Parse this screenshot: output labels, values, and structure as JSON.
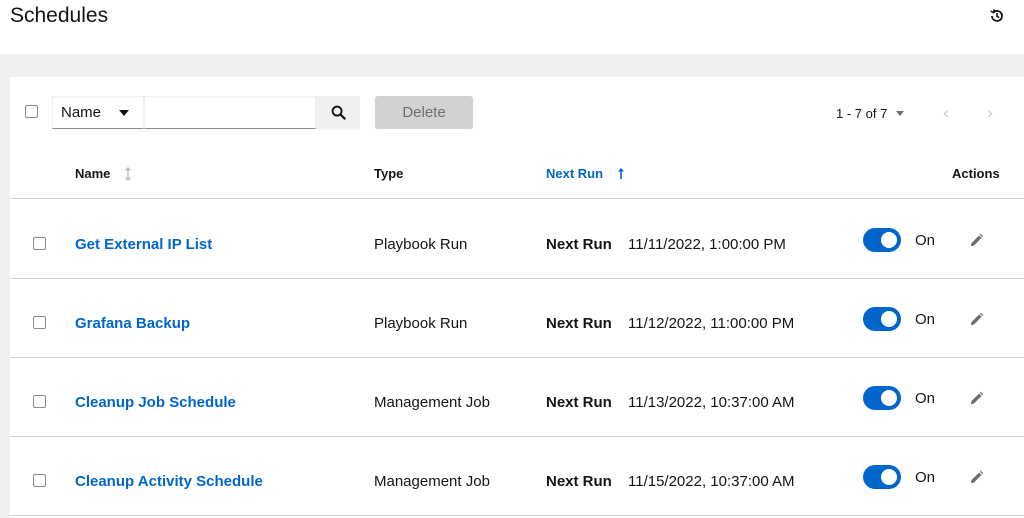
{
  "header": {
    "title": "Schedules",
    "history_icon": "history-icon"
  },
  "toolbar": {
    "filter_field": "Name",
    "search_placeholder": "",
    "search_value": "",
    "search_icon": "search-icon",
    "delete_label": "Delete",
    "pagination": "1 - 7 of 7"
  },
  "table": {
    "columns": {
      "name": "Name",
      "type": "Type",
      "next_run": "Next Run",
      "actions": "Actions"
    },
    "sorted_by": "Next Run",
    "sort_direction": "ascending",
    "rows": [
      {
        "name": "Get External IP List",
        "type": "Playbook Run",
        "next_run_label": "Next Run",
        "next_run": "11/11/2022, 1:00:00 PM",
        "toggle_label": "On",
        "enabled": true
      },
      {
        "name": "Grafana Backup",
        "type": "Playbook Run",
        "next_run_label": "Next Run",
        "next_run": "11/12/2022, 11:00:00 PM",
        "toggle_label": "On",
        "enabled": true
      },
      {
        "name": "Cleanup Job Schedule",
        "type": "Management Job",
        "next_run_label": "Next Run",
        "next_run": "11/13/2022, 10:37:00 AM",
        "toggle_label": "On",
        "enabled": true
      },
      {
        "name": "Cleanup Activity Schedule",
        "type": "Management Job",
        "next_run_label": "Next Run",
        "next_run": "11/15/2022, 10:37:00 AM",
        "toggle_label": "On",
        "enabled": true
      }
    ]
  },
  "colors": {
    "link": "#0066cc",
    "switch_on": "#0066cc",
    "disabled_button": "#d2d2d2"
  }
}
